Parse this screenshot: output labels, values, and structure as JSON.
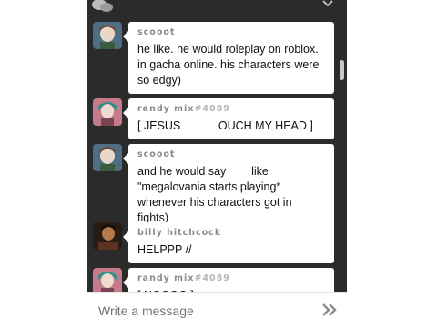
{
  "messages": [
    {
      "user": "scooot",
      "tag": "",
      "lines": [
        "he like. he would roleplay on roblox.",
        "in gacha online. his characters were",
        "so edgy)"
      ],
      "avatar": "light-haired-character-avatar"
    },
    {
      "user": "randy mix",
      "tag": "#4089",
      "lines": [
        "[ JESUS            OUCH MY HEAD ]"
      ],
      "avatar": "pink-haired-character-avatar"
    },
    {
      "user": "scooot",
      "tag": "",
      "lines": [
        "and he would say        like",
        "\"megalovania starts playing*",
        "whenever his characters got in fights)"
      ],
      "avatar": "light-haired-character-avatar"
    },
    {
      "user": "billy hitchcock",
      "tag": "",
      "lines": [
        "HELPPP //"
      ],
      "avatar": "dark-portrait-avatar"
    },
    {
      "user": "randy mix",
      "tag": "#4089",
      "lines": [
        "[ NOOOO ]"
      ],
      "avatar": "pink-haired-character-avatar"
    }
  ],
  "composer": {
    "placeholder": "Write a message"
  },
  "colors": {
    "panel": "#2b2b2b",
    "bubble": "#ffffff",
    "username": "#8a8a8a"
  }
}
